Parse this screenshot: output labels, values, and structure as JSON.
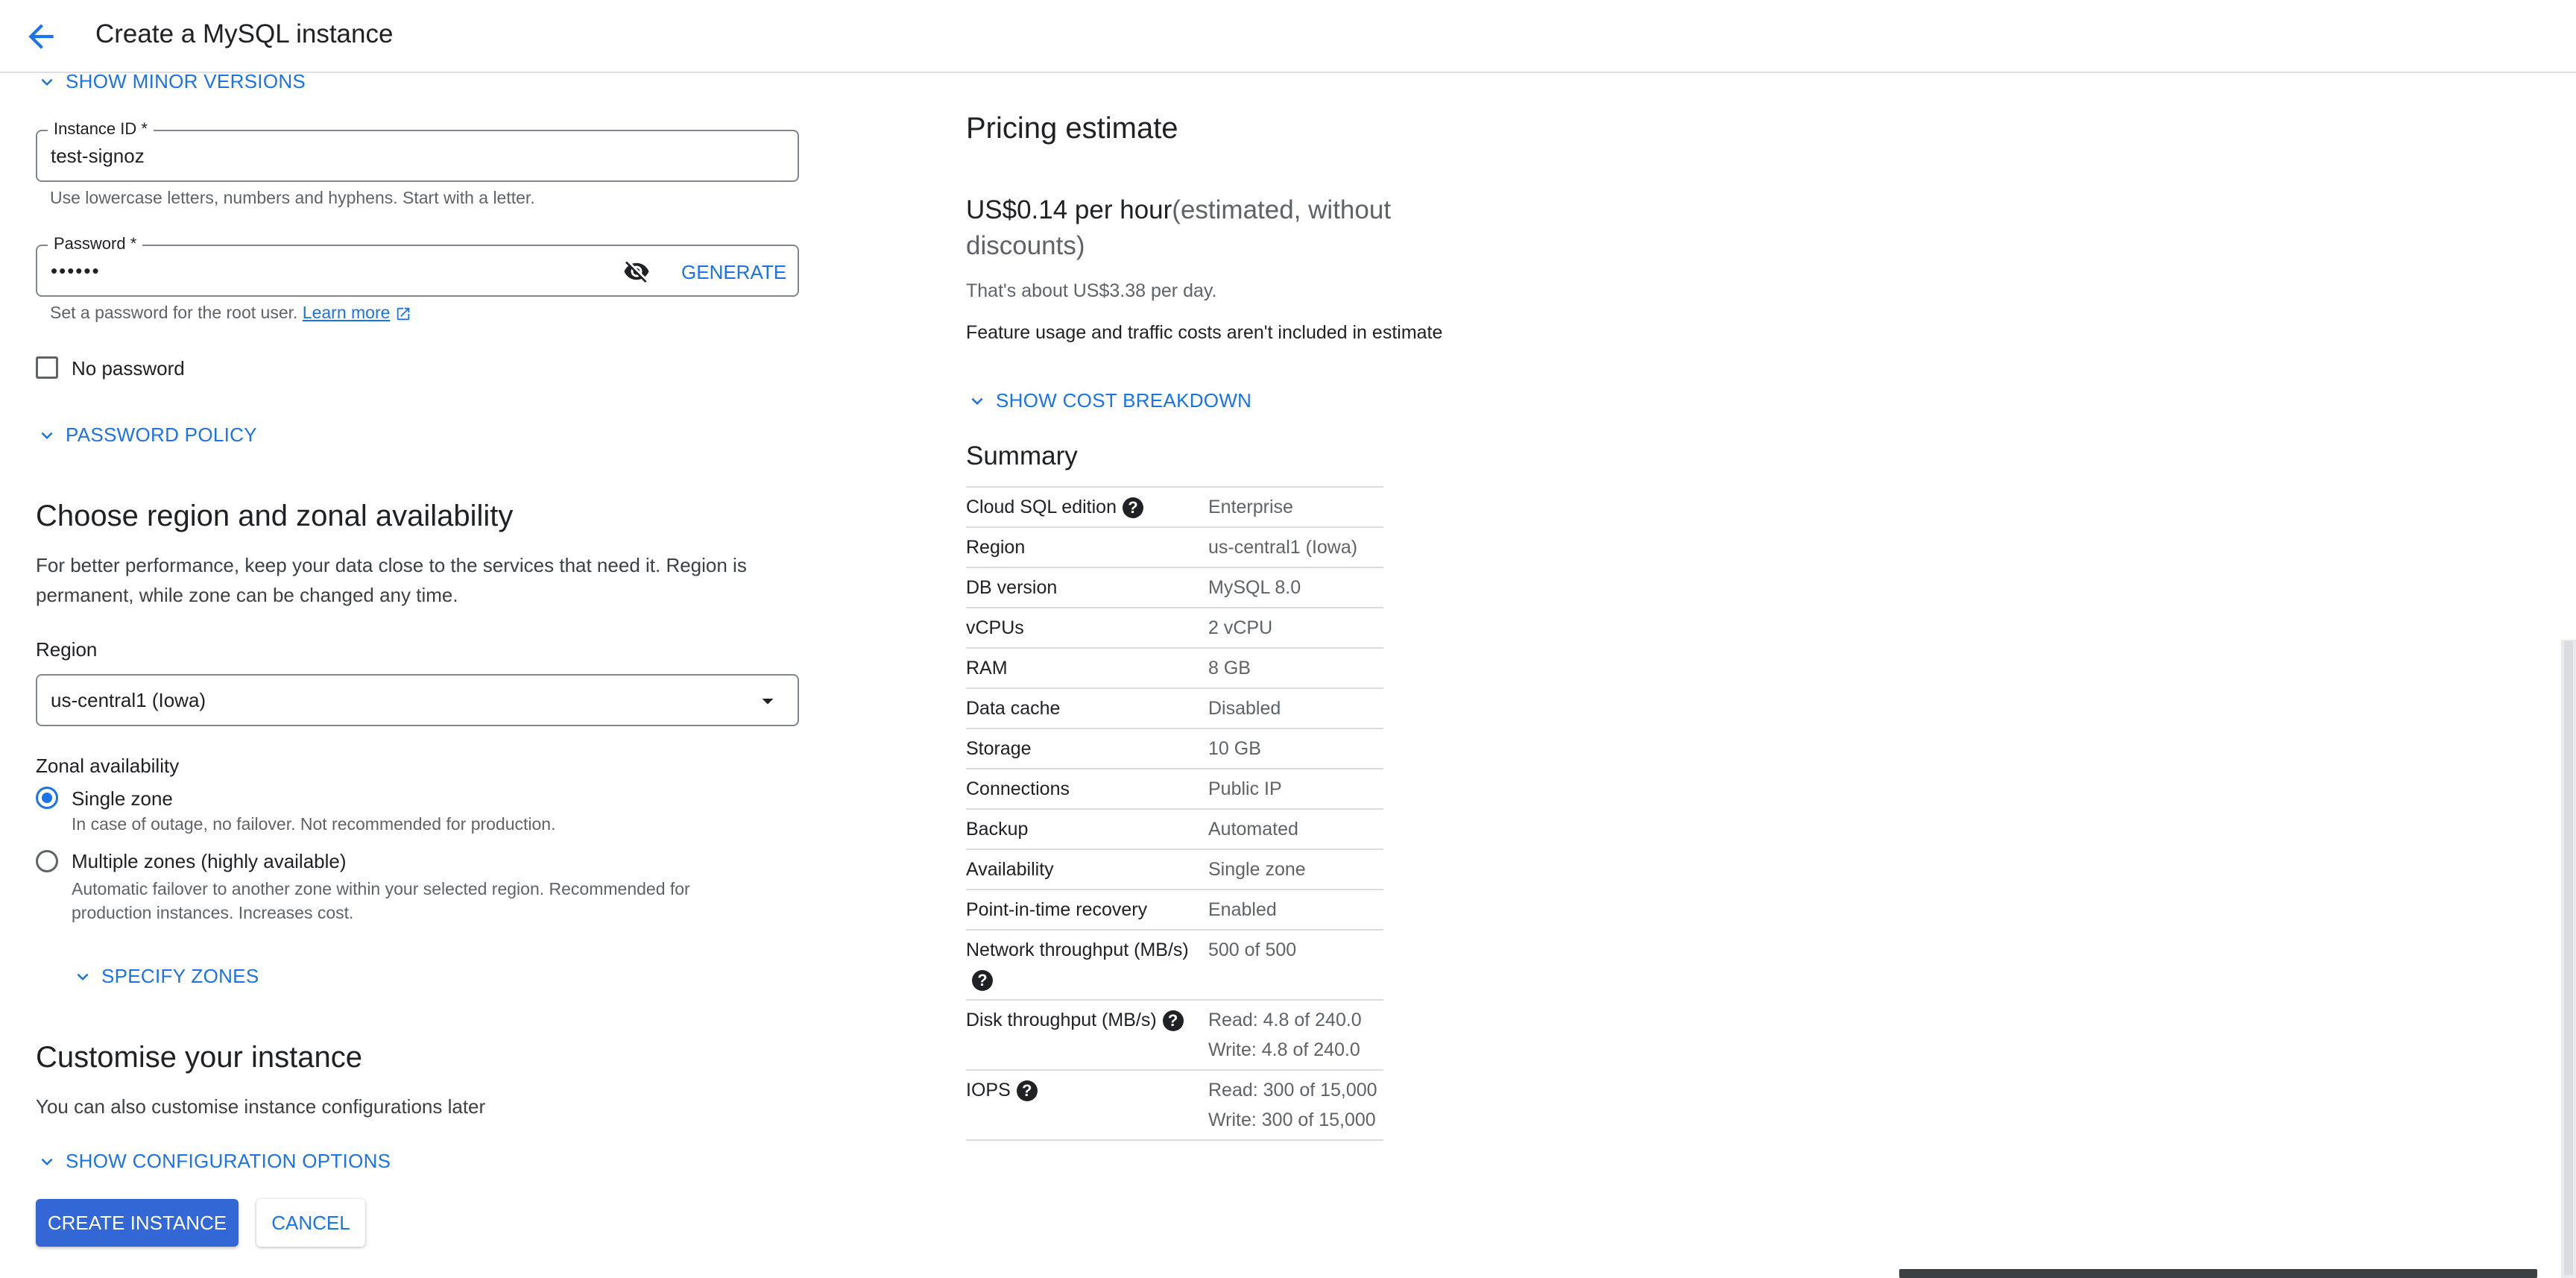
{
  "header": {
    "title": "Create a MySQL instance"
  },
  "left": {
    "show_minor_versions": "SHOW MINOR VERSIONS",
    "instance_id": {
      "label": "Instance ID *",
      "value": "test-signoz",
      "hint": "Use lowercase letters, numbers and hyphens. Start with a letter."
    },
    "password": {
      "label": "Password *",
      "value": "••••••",
      "generate": "GENERATE",
      "hint": "Set a password for the root user.",
      "learn_more": "Learn more"
    },
    "no_password": "No password",
    "password_policy": "PASSWORD POLICY",
    "region_section": {
      "title": "Choose region and zonal availability",
      "description": "For better performance, keep your data close to the services that need it. Region is permanent, while zone can be changed any time.",
      "region_label": "Region",
      "region_value": "us-central1 (Iowa)",
      "zonal_label": "Zonal availability",
      "single_zone": {
        "label": "Single zone",
        "hint": "In case of outage, no failover. Not recommended for production."
      },
      "multi_zone": {
        "label": "Multiple zones (highly available)",
        "hint": "Automatic failover to another zone within your selected region. Recommended for production instances. Increases cost."
      },
      "specify_zones": "SPECIFY ZONES"
    },
    "customise": {
      "title": "Customise your instance",
      "description": "You can also customise instance configurations later",
      "show_config": "SHOW CONFIGURATION OPTIONS"
    },
    "buttons": {
      "create": "CREATE INSTANCE",
      "cancel": "CANCEL"
    }
  },
  "right": {
    "pricing_title": "Pricing estimate",
    "price_main": "US$0.14 per hour",
    "price_note": "(estimated, without discounts)",
    "per_day": "That's about US$3.38 per day.",
    "feature_note": "Feature usage and traffic costs aren't included in estimate",
    "show_cost_breakdown": "SHOW COST BREAKDOWN",
    "summary_title": "Summary",
    "summary": [
      {
        "key": "Cloud SQL edition",
        "value": "Enterprise",
        "help": true
      },
      {
        "key": "Region",
        "value": "us-central1 (Iowa)"
      },
      {
        "key": "DB version",
        "value": "MySQL 8.0"
      },
      {
        "key": "vCPUs",
        "value": "2 vCPU"
      },
      {
        "key": "RAM",
        "value": "8 GB"
      },
      {
        "key": "Data cache",
        "value": "Disabled"
      },
      {
        "key": "Storage",
        "value": "10 GB"
      },
      {
        "key": "Connections",
        "value": "Public IP"
      },
      {
        "key": "Backup",
        "value": "Automated"
      },
      {
        "key": "Availability",
        "value": "Single zone"
      },
      {
        "key": "Point-in-time recovery",
        "value": "Enabled"
      },
      {
        "key": "Network throughput (MB/s)",
        "value": "500 of 500",
        "help": true
      },
      {
        "key": "Disk throughput (MB/s)",
        "value": "Read: 4.8 of 240.0",
        "value2": "Write: 4.8 of 240.0",
        "help": true
      },
      {
        "key": "IOPS",
        "value": "Read: 300 of 15,000",
        "value2": "Write: 300 of 15,000",
        "help": true
      }
    ]
  },
  "colors": {
    "accent": "#1a73e8",
    "primary_button": "#3367d6"
  }
}
